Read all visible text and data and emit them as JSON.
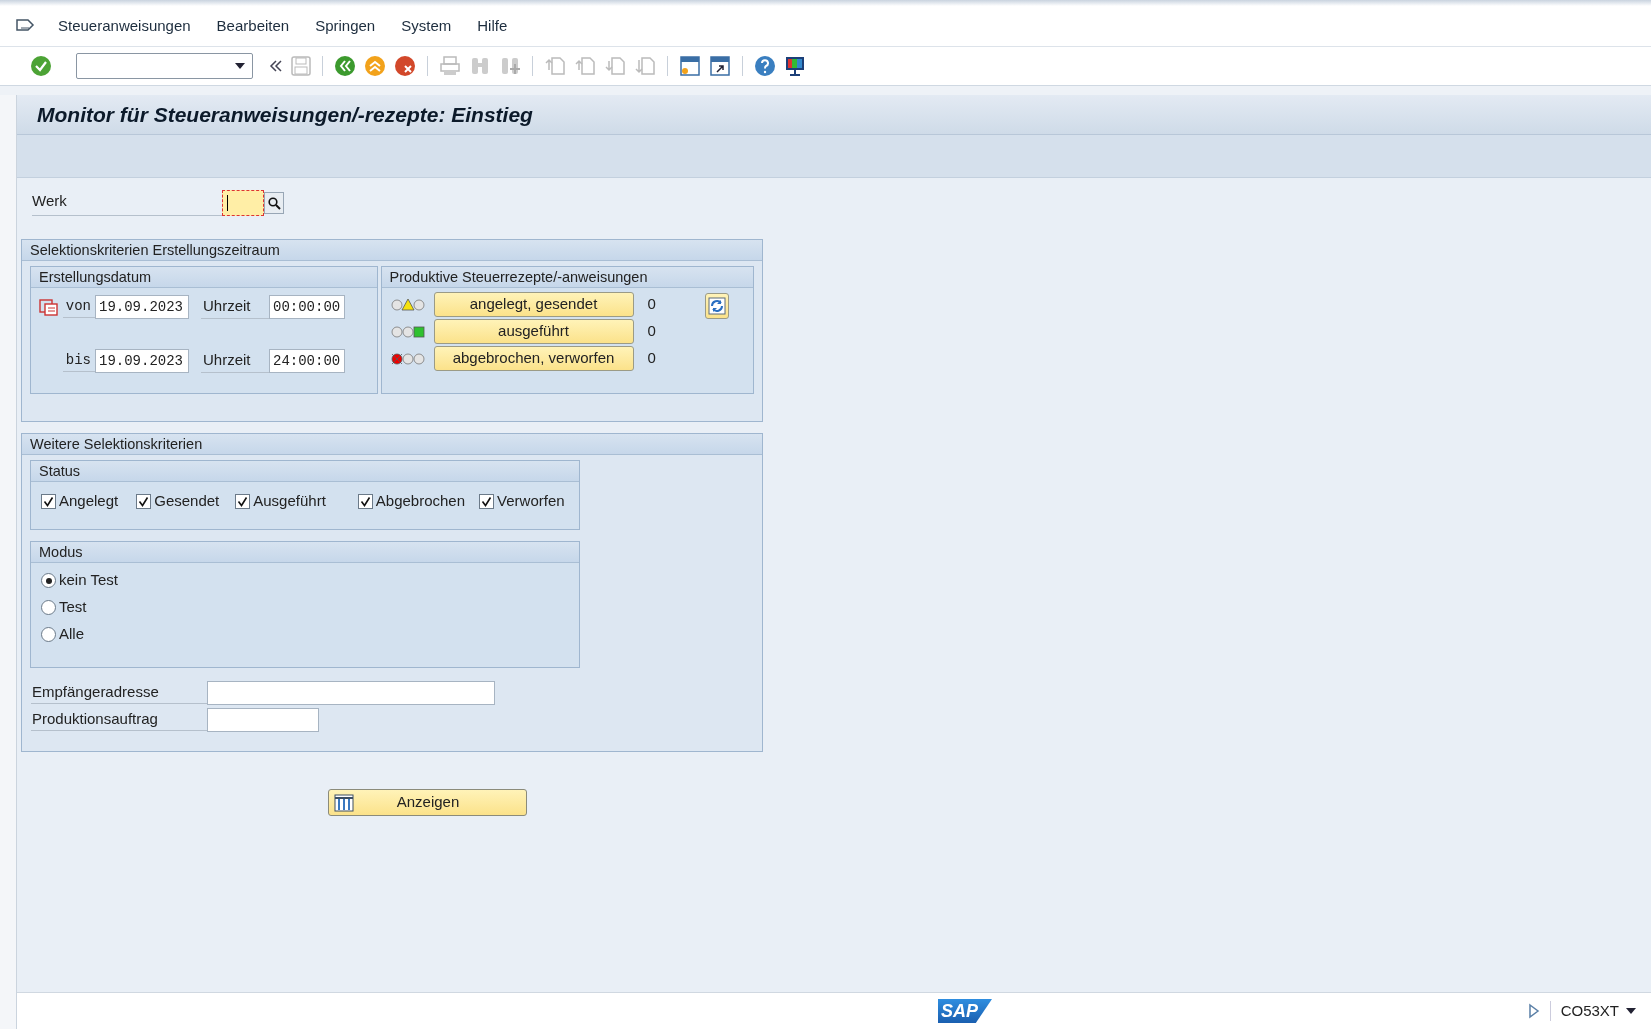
{
  "menu": [
    {
      "label": "Steueranweisungen"
    },
    {
      "label": "Bearbeiten"
    },
    {
      "label": "Springen"
    },
    {
      "label": "System"
    },
    {
      "label": "Hilfe"
    }
  ],
  "title": "Monitor für Steueranweisungen/-rezepte: Einstieg",
  "werk": {
    "label": "Werk"
  },
  "creation_group": {
    "title": "Selektionskriterien Erstellungszeitraum",
    "date_box": {
      "title": "Erstellungsdatum",
      "rows": [
        {
          "label": "von",
          "date": "19.09.2023",
          "time_label": "Uhrzeit",
          "time": "00:00:00"
        },
        {
          "label": "bis",
          "date": "19.09.2023",
          "time_label": "Uhrzeit",
          "time": "24:00:00"
        }
      ]
    },
    "status_box": {
      "title": "Produktive Steuerrezepte/-anweisungen",
      "rows": [
        {
          "kind": "yellow",
          "button": "angelegt, gesendet",
          "count": "0"
        },
        {
          "kind": "green",
          "button": "ausgeführt",
          "count": "0"
        },
        {
          "kind": "red",
          "button": "abgebrochen, verworfen",
          "count": "0"
        }
      ]
    }
  },
  "further_group": {
    "title": "Weitere Selektionskriterien",
    "status": {
      "title": "Status",
      "options": [
        {
          "label": "Angelegt",
          "checked": true
        },
        {
          "label": "Gesendet",
          "checked": true
        },
        {
          "label": "Ausgeführt",
          "checked": true
        },
        {
          "label": "Abgebrochen",
          "checked": true
        },
        {
          "label": "Verworfen",
          "checked": true
        }
      ]
    },
    "mode": {
      "title": "Modus",
      "options": [
        {
          "label": "kein Test",
          "selected": true
        },
        {
          "label": "Test",
          "selected": false
        },
        {
          "label": "Alle",
          "selected": false
        }
      ]
    },
    "fields": [
      {
        "label": "Empfängeradresse"
      },
      {
        "label": "Produktionsauftrag"
      }
    ]
  },
  "action_button": "Anzeigen",
  "status_bar": {
    "logo": "SAP",
    "transaction": "CO53XT"
  }
}
